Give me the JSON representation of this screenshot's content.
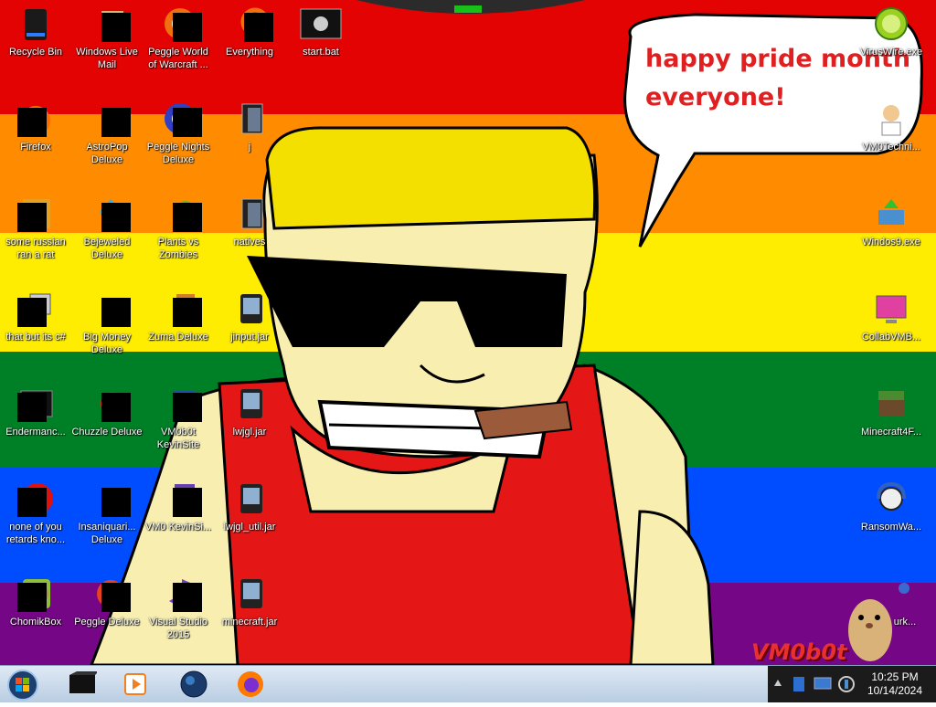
{
  "wallpaper": {
    "stripe_colors": [
      "#e40303",
      "#ff8c00",
      "#ffed00",
      "#008026",
      "#004dff",
      "#750787"
    ],
    "speech_bubble_line1": "happy pride month",
    "speech_bubble_line2": "everyone!",
    "watermark": "VM0b0t"
  },
  "desktop_icons": {
    "col1": [
      "Recycle Bin",
      "Firefox",
      "some russian ran a rat",
      "that but its c#",
      "Endermanc...",
      "none of you retards kno...",
      "ChomikBox"
    ],
    "col2": [
      "Windows Live Mail",
      "AstroPop Deluxe",
      "Bejeweled Deluxe",
      "Big Money Deluxe",
      "Chuzzle Deluxe",
      "Insaniquari... Deluxe",
      "Peggle Deluxe"
    ],
    "col3": [
      "Peggle World of Warcraft ...",
      "Peggle Nights Deluxe",
      "Plants vs Zombies",
      "Zuma Deluxe",
      "VM0b0t KevinSite",
      "VM0 KevinSi...",
      "Visual Studio 2015"
    ],
    "col4": [
      "Everything",
      "j",
      "natives",
      "jinput.jar",
      "lwjgl.jar",
      "lwjgl_util.jar",
      "minecraft.jar"
    ],
    "col5": [
      "start.bat"
    ],
    "right": [
      "VirusWire.exe",
      "VM0Techni...",
      "Windos9.exe",
      "CollabVMB...",
      "Minecraft4F...",
      "RansomWa...",
      "urk..."
    ]
  },
  "taskbar": {
    "start_icon": "windows-orb-icon",
    "pinned": [
      "terminal-icon",
      "media-player-icon",
      "globe-icon",
      "firefox-icon"
    ],
    "tray_icons": [
      "chevron-up-icon",
      "network-icon",
      "monitor-icon",
      "volume-icon"
    ],
    "clock_time": "10:25 PM",
    "clock_date": "10/14/2024"
  }
}
